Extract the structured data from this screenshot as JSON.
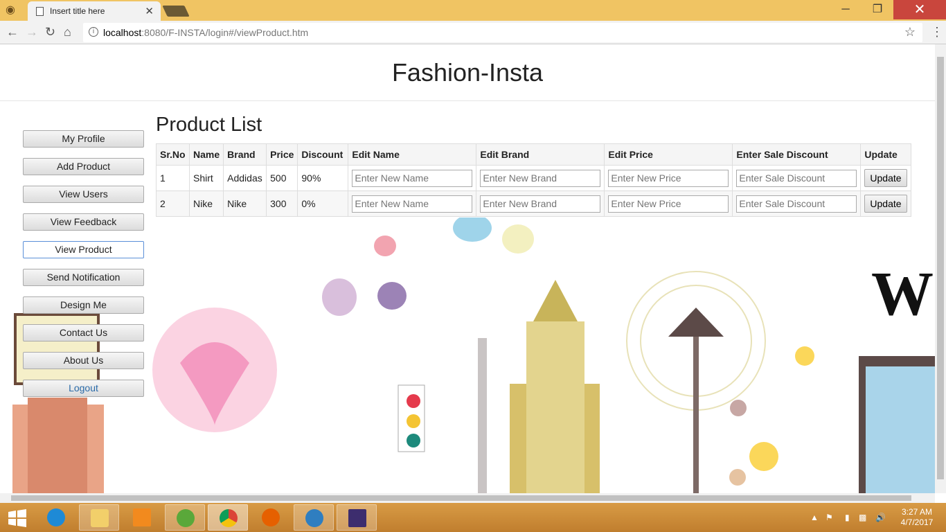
{
  "browser": {
    "tab_title": "Insert title here",
    "url_host": "localhost",
    "url_path": ":8080/F-INSTA/login#/viewProduct.htm"
  },
  "site": {
    "title": "Fashion-Insta"
  },
  "sidebar": {
    "items": [
      {
        "label": "My Profile"
      },
      {
        "label": "Add Product"
      },
      {
        "label": "View Users"
      },
      {
        "label": "View Feedback"
      },
      {
        "label": "View Product"
      },
      {
        "label": "Send Notification"
      },
      {
        "label": "Design Me"
      },
      {
        "label": "Contact Us"
      },
      {
        "label": "About Us"
      },
      {
        "label": "Logout"
      }
    ]
  },
  "main": {
    "heading": "Product List",
    "columns": [
      "Sr.No",
      "Name",
      "Brand",
      "Price",
      "Discount",
      "Edit Name",
      "Edit Brand",
      "Edit Price",
      "Enter Sale Discount",
      "Update"
    ],
    "rows": [
      {
        "srno": "1",
        "name": "Shirt",
        "brand": "Addidas",
        "price": "500",
        "discount": "90%"
      },
      {
        "srno": "2",
        "name": "Nike",
        "brand": "Nike",
        "price": "300",
        "discount": "0%"
      }
    ],
    "placeholders": {
      "name": "Enter New Name",
      "brand": "Enter New Brand",
      "price": "Enter New Price",
      "discount": "Enter Sale Discount"
    },
    "update_label": "Update"
  },
  "taskbar": {
    "time": "3:27 AM",
    "date": "4/7/2017"
  }
}
